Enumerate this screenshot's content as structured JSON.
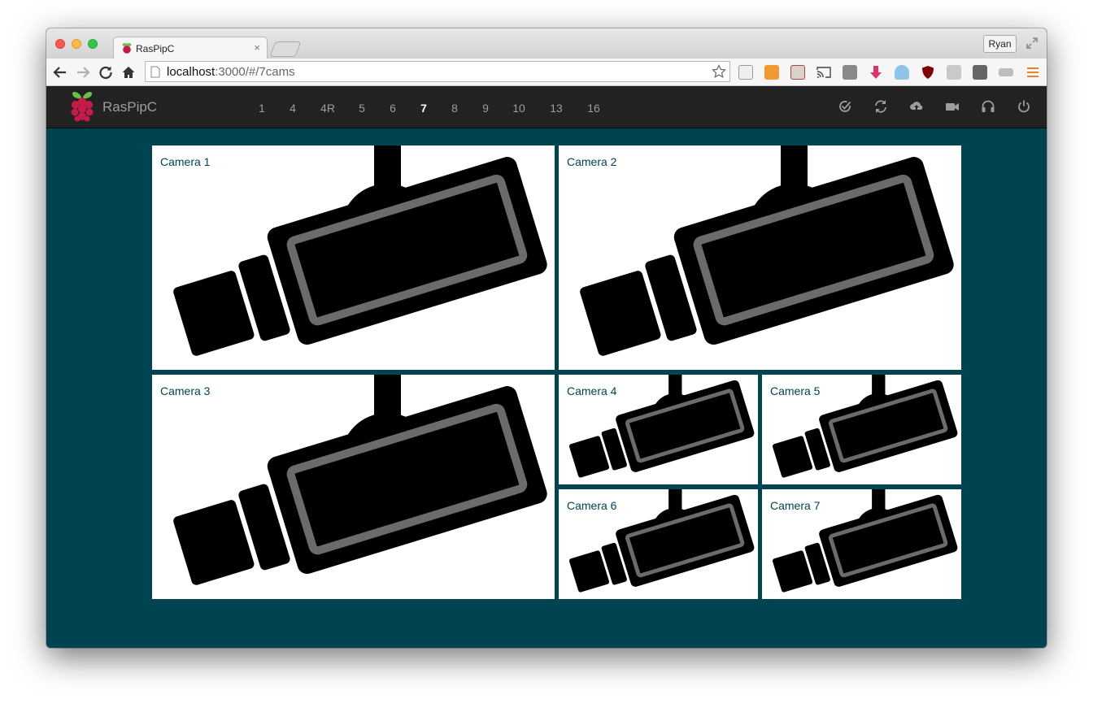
{
  "browser": {
    "tab_title": "RasPipC",
    "tab_close": "×",
    "profile_name": "Ryan",
    "url_host": "localhost",
    "url_rest": ":3000/#/7cams"
  },
  "app": {
    "brand": "RasPipC",
    "layouts": [
      {
        "label": "1",
        "active": false
      },
      {
        "label": "4",
        "active": false
      },
      {
        "label": "4R",
        "active": false
      },
      {
        "label": "5",
        "active": false
      },
      {
        "label": "6",
        "active": false
      },
      {
        "label": "7",
        "active": true
      },
      {
        "label": "8",
        "active": false
      },
      {
        "label": "9",
        "active": false
      },
      {
        "label": "10",
        "active": false
      },
      {
        "label": "13",
        "active": false
      },
      {
        "label": "16",
        "active": false
      }
    ],
    "tools": [
      "check-circle-icon",
      "refresh-icon",
      "cloud-upload-icon",
      "video-camera-icon",
      "headphones-icon",
      "power-icon"
    ]
  },
  "cameras": [
    {
      "label": "Camera 1"
    },
    {
      "label": "Camera 2"
    },
    {
      "label": "Camera 3"
    },
    {
      "label": "Camera 4"
    },
    {
      "label": "Camera 5"
    },
    {
      "label": "Camera 6"
    },
    {
      "label": "Camera 7"
    }
  ],
  "colors": {
    "page_background": "#004452",
    "navbar": "#222222",
    "camera_label": "#004452",
    "raspberry": "#c51a4a",
    "leaf": "#6cc04a"
  }
}
